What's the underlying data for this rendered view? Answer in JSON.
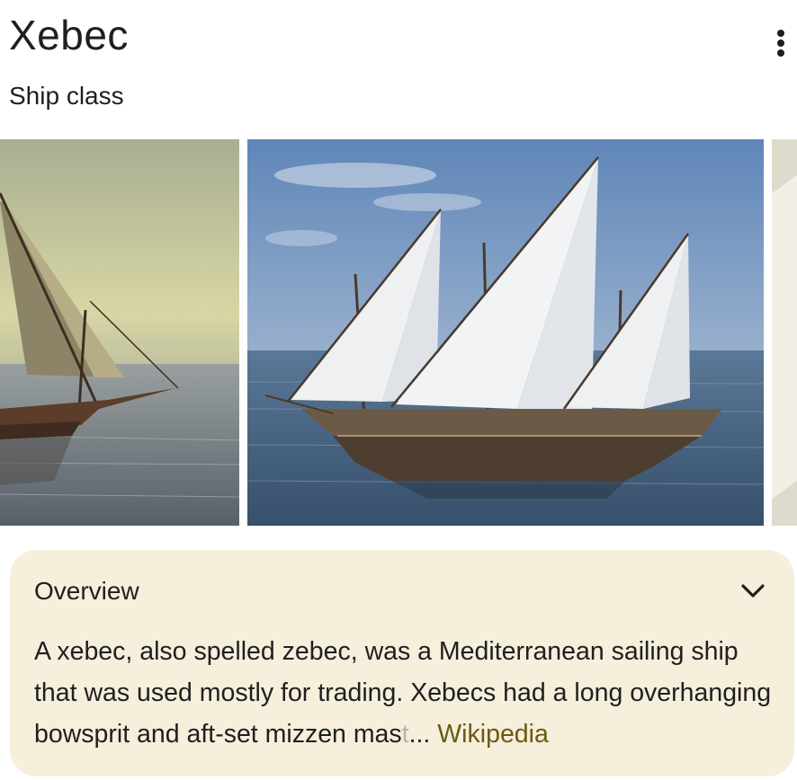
{
  "header": {
    "title": "Xebec",
    "subtitle": "Ship class",
    "menu_icon": "more-vert-icon"
  },
  "gallery": {
    "images": [
      {
        "alt": "lateen-sail-ship-in-hazy-sea"
      },
      {
        "alt": "three-masted-xebec-on-blue-sea"
      },
      {
        "alt": "partial-third-image"
      }
    ]
  },
  "overview": {
    "heading": "Overview",
    "expand_icon": "chevron-down-icon",
    "text_main": "A xebec, also spelled zebec, was a Mediterranean sailing ship that was used mostly for trading. Xebecs had a long overhanging bowsprit and aft-set mizzen mas",
    "text_fade": "t",
    "ellipsis": "... ",
    "source_label": "Wikipedia"
  },
  "colors": {
    "card_bg": "#f6efdc",
    "link": "#6b5a12",
    "text": "#1f1f1f"
  }
}
